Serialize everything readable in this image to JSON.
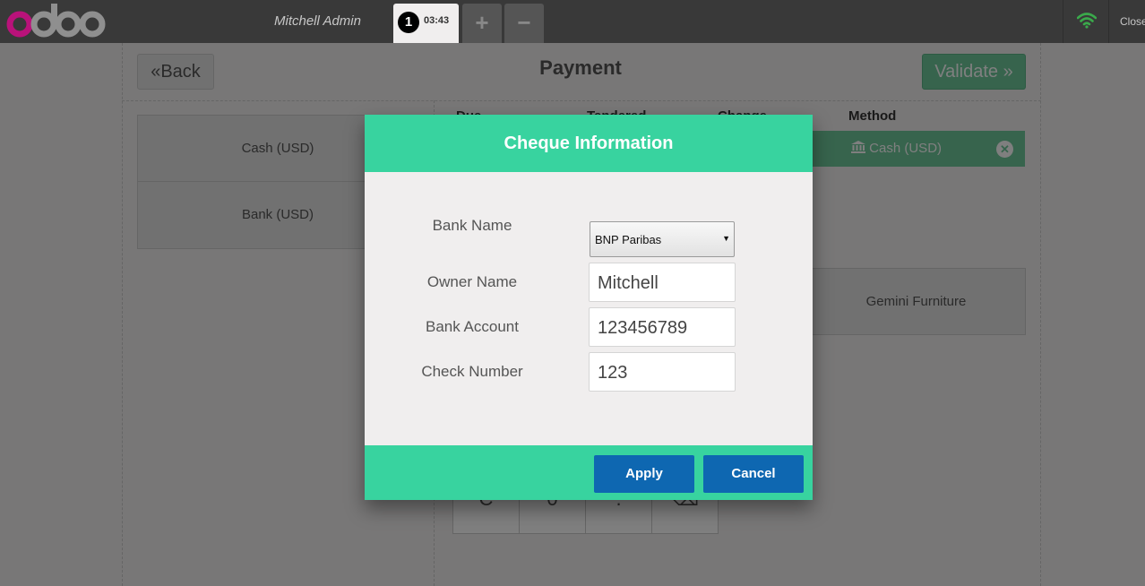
{
  "topbar": {
    "cashier": "Mitchell Admin",
    "order_number": "1",
    "order_time": "03:43",
    "add_order_label": "+",
    "remove_order_label": "−",
    "close_label": "Close"
  },
  "payment_screen": {
    "title": "Payment",
    "back_label": "Back",
    "validate_label": "Validate",
    "payment_methods": [
      "Cash (USD)",
      "Bank (USD)"
    ],
    "columns": {
      "due": "Due",
      "tendered": "Tendered",
      "change": "Change",
      "method": "Method"
    },
    "payment_line": {
      "method": "Cash (USD)"
    },
    "customer": "Gemini Furniture",
    "numpad_visible_row": [
      "C",
      "0",
      ".",
      "⌫"
    ]
  },
  "popup": {
    "title": "Cheque Information",
    "fields": {
      "bank_name": {
        "label": "Bank Name",
        "value": "BNP Paribas"
      },
      "owner_name": {
        "label": "Owner Name",
        "value": "Mitchell"
      },
      "bank_account": {
        "label": "Bank Account",
        "value": "123456789"
      },
      "check_number": {
        "label": "Check Number",
        "value": "123"
      }
    },
    "apply_label": "Apply",
    "cancel_label": "Cancel"
  },
  "colors": {
    "popup_accent": "#38d39f",
    "button_blue": "#0e67b1",
    "odoo_purple": "#875a7b",
    "odoo_magenta": "#b9127a",
    "wifi_green": "#3aa94b"
  },
  "icons": {
    "back": "double-chevron-left-icon",
    "validate": "double-chevron-right-icon",
    "bank": "bank-building-icon",
    "delete": "remove-circle-icon",
    "wifi": "wifi-icon"
  }
}
